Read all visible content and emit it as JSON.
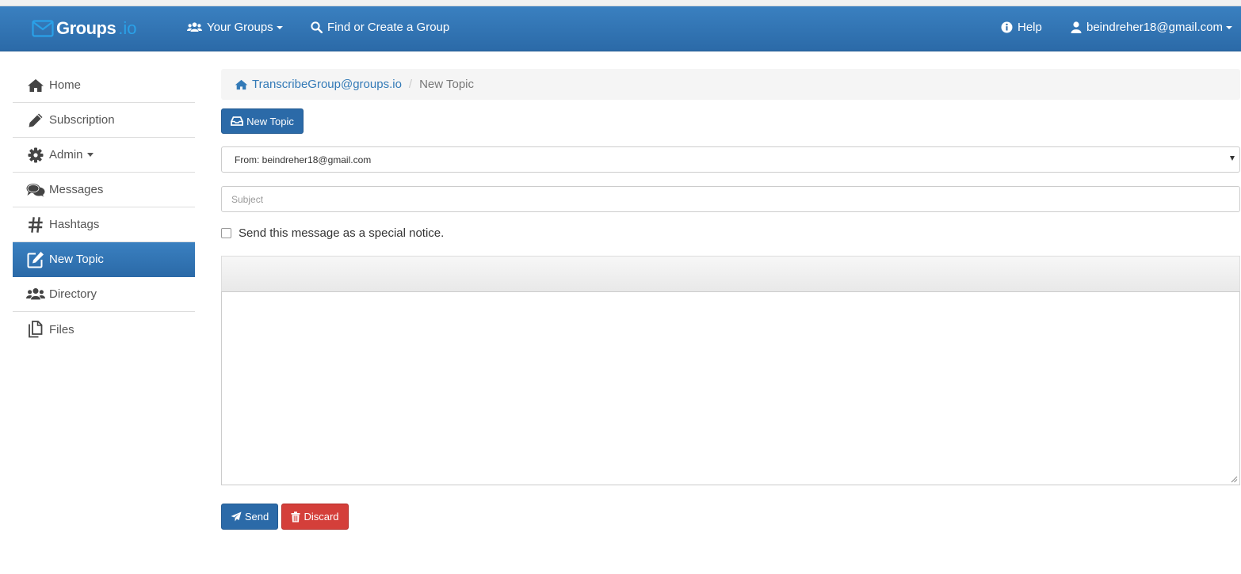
{
  "navbar": {
    "brand_name": "Groups",
    "brand_tld": ".io",
    "your_groups": "Your Groups",
    "find_create": "Find or Create a Group",
    "help": "Help",
    "user_email": "beindreher18@gmail.com"
  },
  "sidebar": {
    "items": [
      {
        "label": "Home",
        "icon": "home-icon"
      },
      {
        "label": "Subscription",
        "icon": "pencil-icon"
      },
      {
        "label": "Admin",
        "icon": "gear-icon"
      },
      {
        "label": "Messages",
        "icon": "comments-icon"
      },
      {
        "label": "Hashtags",
        "icon": "hashtag-icon"
      },
      {
        "label": "New Topic",
        "icon": "edit-icon",
        "active": true
      },
      {
        "label": "Directory",
        "icon": "users-icon"
      },
      {
        "label": "Files",
        "icon": "files-icon"
      }
    ]
  },
  "breadcrumb": {
    "group": "TranscribeGroup@groups.io",
    "current": "New Topic"
  },
  "compose": {
    "header_button": "New Topic",
    "from": "From: beindreher18@gmail.com",
    "subject_placeholder": "Subject",
    "subject_value": "",
    "special_notice": "Send this message as a special notice.",
    "special_notice_checked": false,
    "send": "Send",
    "discard": "Discard"
  },
  "colors": {
    "navbar": "#2b6aa8",
    "primary_button": "#2b6aa8",
    "danger_button": "#d43f3a",
    "link": "#337ab7"
  }
}
